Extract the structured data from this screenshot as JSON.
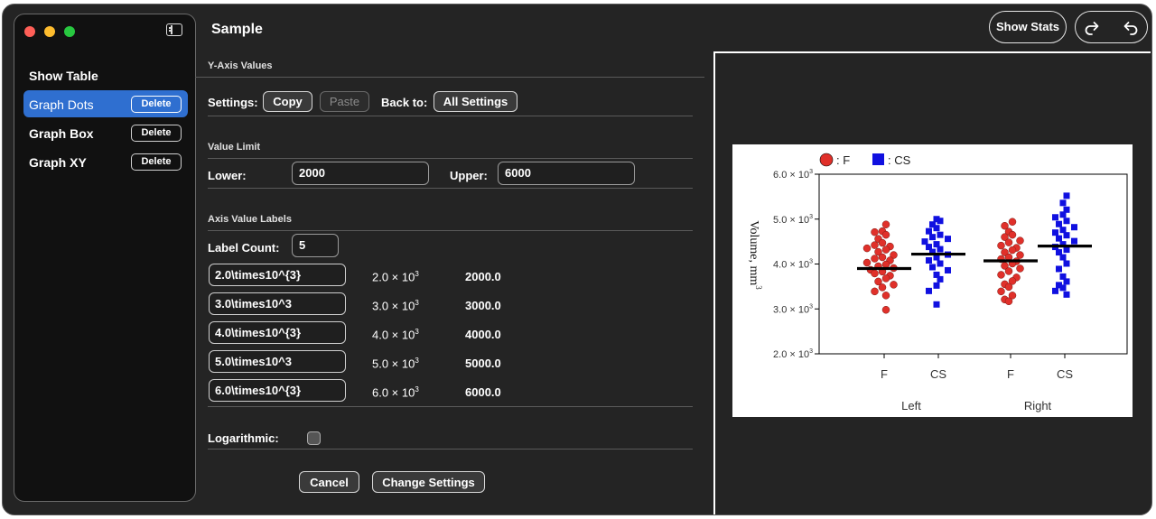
{
  "window": {
    "title": "Sample"
  },
  "sidebar": {
    "items": [
      {
        "label": "Show Table"
      },
      {
        "label": "Graph Dots",
        "delete_label": "Delete",
        "selected": true
      },
      {
        "label": "Graph Box",
        "delete_label": "Delete"
      },
      {
        "label": "Graph XY",
        "delete_label": "Delete"
      }
    ]
  },
  "toolbar": {
    "show_stats_label": "Show Stats",
    "redo_icon": "redo-icon",
    "undo_icon": "undo-icon"
  },
  "settings": {
    "section_title": "Y-Axis Values",
    "settings_label": "Settings:",
    "copy_label": "Copy",
    "paste_label": "Paste",
    "back_to_label": "Back to:",
    "all_settings_label": "All Settings",
    "value_limit": {
      "title": "Value Limit",
      "lower_label": "Lower:",
      "lower_value": "2000",
      "upper_label": "Upper:",
      "upper_value": "6000"
    },
    "axis_labels": {
      "title": "Axis Value Labels",
      "count_label": "Label Count:",
      "count_value": "5",
      "rows": [
        {
          "input": "2.0\\times10^{3}",
          "mantissa": "2.0 × 10",
          "exp": "3",
          "value": "2000.0"
        },
        {
          "input": "3.0\\times10^3",
          "mantissa": "3.0 × 10",
          "exp": "3",
          "value": "3000.0"
        },
        {
          "input": "4.0\\times10^{3}",
          "mantissa": "4.0 × 10",
          "exp": "3",
          "value": "4000.0"
        },
        {
          "input": "5.0\\times10^3",
          "mantissa": "5.0 × 10",
          "exp": "3",
          "value": "5000.0"
        },
        {
          "input": "6.0\\times10^{3}",
          "mantissa": "6.0 × 10",
          "exp": "3",
          "value": "6000.0"
        }
      ]
    },
    "logarithmic_label": "Logarithmic:",
    "logarithmic": false,
    "cancel_label": "Cancel",
    "change_label": "Change Settings"
  },
  "chart_data": {
    "type": "scatter",
    "legend": [
      {
        "name": ": F",
        "color": "#e0302a",
        "marker": "circle"
      },
      {
        "name": ": CS",
        "color": "#1010e0",
        "marker": "square"
      }
    ],
    "ylabel": "Volume, mm",
    "ylabel_exp": "3",
    "ylim": [
      2000,
      6000
    ],
    "yticks": [
      {
        "mantissa": "2.0 × 10",
        "exp": "3",
        "value": 2000
      },
      {
        "mantissa": "3.0 × 10",
        "exp": "3",
        "value": 3000
      },
      {
        "mantissa": "4.0 × 10",
        "exp": "3",
        "value": 4000
      },
      {
        "mantissa": "5.0 × 10",
        "exp": "3",
        "value": 5000
      },
      {
        "mantissa": "6.0 × 10",
        "exp": "3",
        "value": 6000
      }
    ],
    "categories": [
      "F",
      "CS",
      "F",
      "CS"
    ],
    "groups": [
      "Left",
      "Right"
    ],
    "series": [
      {
        "name": "Left F",
        "marker": "circle",
        "color": "#e0302a",
        "mean": 3900,
        "values": [
          4880,
          4730,
          4710,
          4650,
          4560,
          4470,
          4420,
          4390,
          4350,
          4320,
          4270,
          4200,
          4150,
          4120,
          4080,
          4030,
          3990,
          3950,
          3910,
          3870,
          3830,
          3790,
          3740,
          3680,
          3610,
          3540,
          3480,
          3390,
          3300,
          2980
        ]
      },
      {
        "name": "Left CS",
        "marker": "square",
        "color": "#1010e0",
        "mean": 4220,
        "values": [
          5000,
          4960,
          4880,
          4800,
          4730,
          4650,
          4600,
          4560,
          4500,
          4440,
          4380,
          4330,
          4270,
          4210,
          4150,
          4080,
          4010,
          3930,
          3860,
          3760,
          3660,
          3520,
          3400,
          3100
        ]
      },
      {
        "name": "Right F",
        "marker": "circle",
        "color": "#e0302a",
        "mean": 4070,
        "values": [
          4940,
          4850,
          4720,
          4650,
          4600,
          4520,
          4480,
          4410,
          4360,
          4310,
          4260,
          4200,
          4150,
          4110,
          4060,
          4010,
          3960,
          3900,
          3840,
          3760,
          3700,
          3620,
          3550,
          3490,
          3390,
          3300,
          3210,
          3170
        ]
      },
      {
        "name": "Right CS",
        "marker": "square",
        "color": "#1010e0",
        "mean": 4400,
        "values": [
          5520,
          5360,
          5210,
          5100,
          5040,
          4960,
          4890,
          4820,
          4760,
          4700,
          4640,
          4570,
          4510,
          4440,
          4380,
          4320,
          4260,
          4150,
          4010,
          3890,
          3720,
          3610,
          3530,
          3470,
          3400,
          3320
        ]
      }
    ]
  }
}
